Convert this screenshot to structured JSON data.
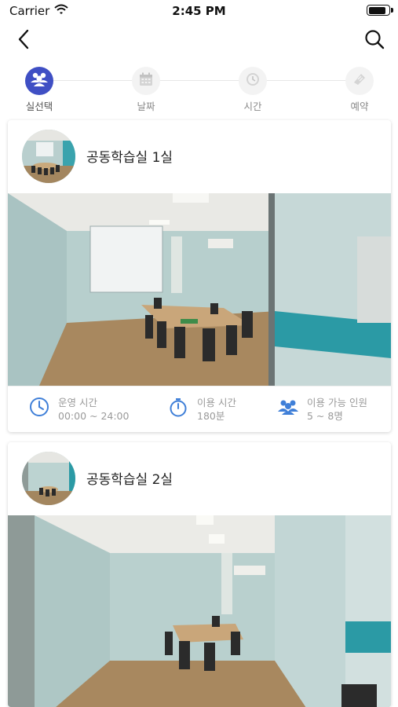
{
  "status_bar": {
    "carrier": "Carrier",
    "time": "2:45 PM",
    "battery_level": 0.9
  },
  "nav": {
    "back_icon": "chevron-left-icon",
    "search_icon": "search-icon"
  },
  "stepper": {
    "steps": [
      {
        "label": "실선택",
        "icon": "people-icon",
        "active": true
      },
      {
        "label": "날짜",
        "icon": "calendar-icon",
        "active": false
      },
      {
        "label": "시간",
        "icon": "clock-icon",
        "active": false
      },
      {
        "label": "예약",
        "icon": "ticket-icon",
        "active": false
      }
    ]
  },
  "rooms": [
    {
      "name": "공동학습실 1실",
      "info": [
        {
          "label": "운영 시간",
          "value": "00:00 ~ 24:00",
          "icon": "clock-icon"
        },
        {
          "label": "이용 시간",
          "value": "180분",
          "icon": "stopwatch-icon"
        },
        {
          "label": "이용 가능 인원",
          "value": "5 ~ 8명",
          "icon": "people-icon"
        }
      ]
    },
    {
      "name": "공동학습실 2실"
    }
  ],
  "colors": {
    "accent": "#3f4fc4",
    "icon_blue": "#3f7fd8",
    "step_inactive": "#c8c8c8"
  }
}
